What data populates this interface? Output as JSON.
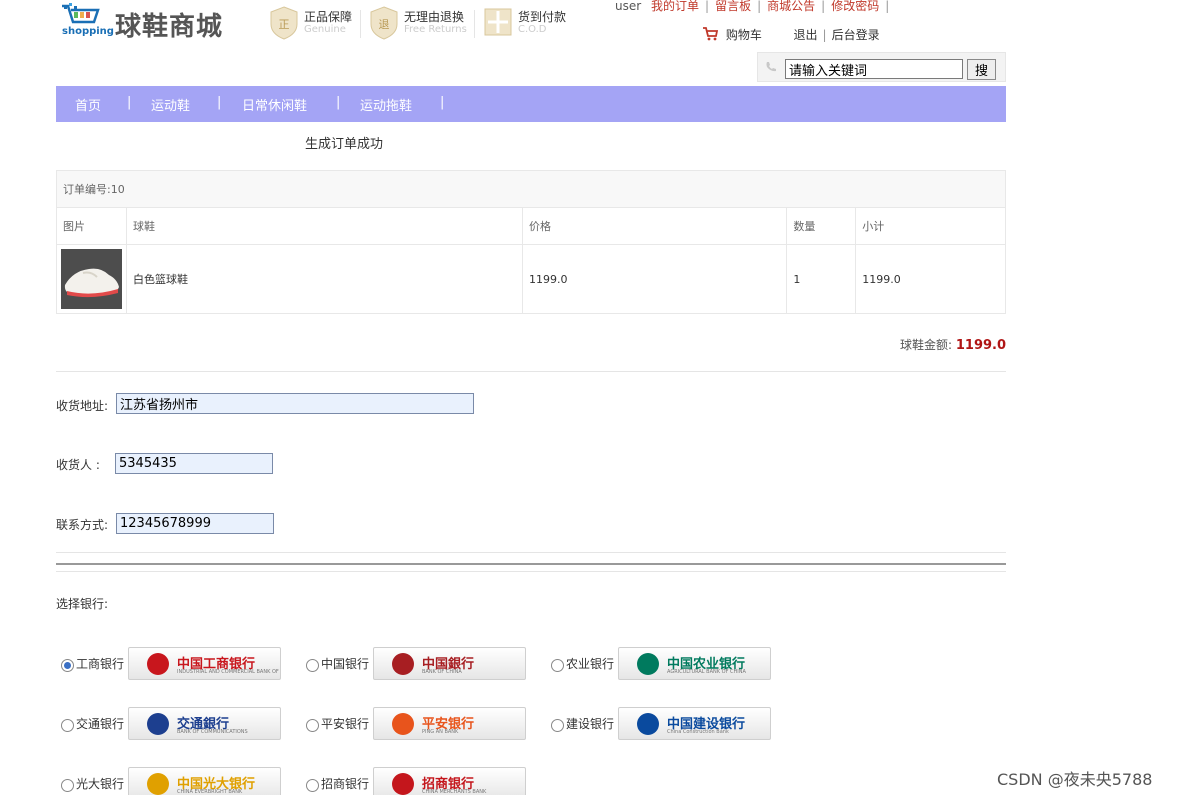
{
  "header": {
    "logo_word": "shopping",
    "site_name": "球鞋商城",
    "promos": [
      {
        "icon": "genuine-badge-icon",
        "title": "正品保障",
        "subtitle": "Genuine"
      },
      {
        "icon": "free-returns-badge-icon",
        "title": "无理由退换",
        "subtitle": "Free Returns"
      },
      {
        "icon": "cod-badge-icon",
        "title": "货到付款",
        "subtitle": "C.O.D"
      }
    ],
    "user": "user",
    "top_links": [
      "我的订单",
      "留言板",
      "商城公告",
      "修改密码"
    ],
    "cart_label": "购物车",
    "logout_label": "退出",
    "admin_label": "后台登录"
  },
  "search": {
    "placeholder": "请输入关键词",
    "value": "请输入关键词",
    "button": "搜"
  },
  "nav": {
    "items": [
      "首页",
      "运动鞋",
      "日常休闲鞋",
      "运动拖鞋"
    ]
  },
  "status_message": "生成订单成功",
  "order": {
    "id_label": "订单编号:10",
    "columns": [
      "图片",
      "球鞋",
      "价格",
      "数量",
      "小计"
    ],
    "rows": [
      {
        "name": "白色篮球鞋",
        "price": "1199.0",
        "qty": "1",
        "subtotal": "1199.0"
      }
    ],
    "total_label": "球鞋金额:",
    "total_value": "1199.0"
  },
  "form": {
    "address_label": "收货地址:",
    "address_value": "江苏省扬州市",
    "receiver_label": "收货人  :",
    "receiver_value": "5345435",
    "phone_label": "联系方式:",
    "phone_value": "12345678999"
  },
  "banks": {
    "title": "选择银行:",
    "options": [
      {
        "label": "工商银行",
        "logo_text": "中国工商银行",
        "logo_sub": "INDUSTRIAL AND COMMERCIAL BANK OF CHINA",
        "selected": true,
        "color": "#c8161d"
      },
      {
        "label": "中国银行",
        "logo_text": "中国銀行",
        "logo_sub": "BANK OF CHINA",
        "selected": false,
        "color": "#a71e22"
      },
      {
        "label": "农业银行",
        "logo_text": "中国农业银行",
        "logo_sub": "AGRICULTURAL BANK OF CHINA",
        "selected": false,
        "color": "#007a5e"
      },
      {
        "label": "交通银行",
        "logo_text": "交通銀行",
        "logo_sub": "BANK OF COMMUNICATIONS",
        "selected": false,
        "color": "#1d3f8f"
      },
      {
        "label": "平安银行",
        "logo_text": "平安银行",
        "logo_sub": "PING AN BANK",
        "selected": false,
        "color": "#e8541c"
      },
      {
        "label": "建设银行",
        "logo_text": "中国建设银行",
        "logo_sub": "China Construction Bank",
        "selected": false,
        "color": "#0a4a9e"
      },
      {
        "label": "光大银行",
        "logo_text": "中国光大银行",
        "logo_sub": "CHINA EVERBRIGHT BANK",
        "selected": false,
        "color": "#e0a000"
      },
      {
        "label": "招商银行",
        "logo_text": "招商银行",
        "logo_sub": "CHINA MERCHANTS BANK",
        "selected": false,
        "color": "#c4161c"
      }
    ]
  },
  "watermark": "CSDN @夜未央5788"
}
